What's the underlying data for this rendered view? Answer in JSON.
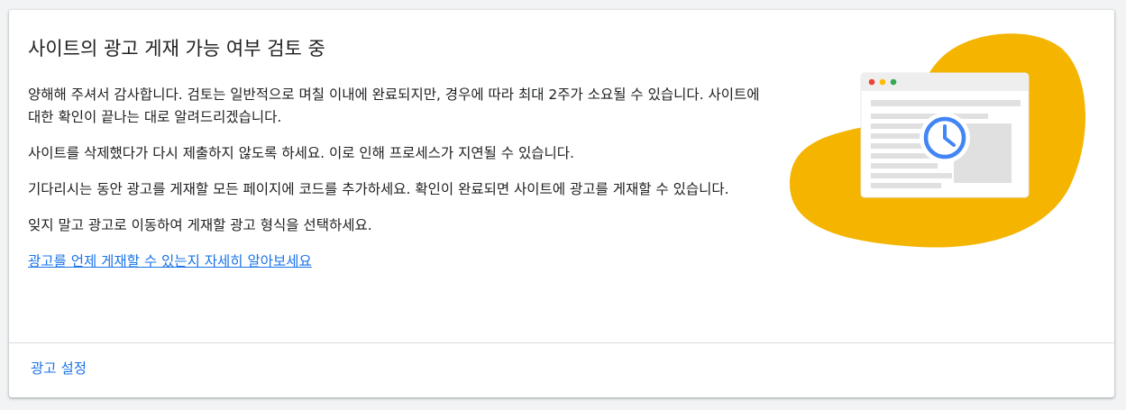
{
  "card": {
    "title": "사이트의 광고 게재 가능 여부 검토 중",
    "paragraphs": [
      "양해해 주셔서 감사합니다. 검토는 일반적으로 며칠 이내에 완료되지만, 경우에 따라 최대 2주가 소요될 수 있습니다. 사이트에 대한 확인이 끝나는 대로 알려드리겠습니다.",
      "사이트를 삭제했다가 다시 제출하지 않도록 하세요. 이로 인해 프로세스가 지연될 수 있습니다.",
      "기다리시는 동안 광고를 게재할 모든 페이지에 코드를 추가하세요. 확인이 완료되면 사이트에 광고를 게재할 수 있습니다.",
      "잊지 말고 광고로 이동하여 게재할 광고 형식을 선택하세요."
    ],
    "learn_more_link": "광고를 언제 게재할 수 있는지 자세히 알아보세요",
    "footer_action": "광고 설정"
  },
  "illustration": {
    "icon": "clock-icon",
    "blob_color": "#f4b400",
    "window_dots": [
      "#ea4335",
      "#fbbc04",
      "#34a853"
    ],
    "clock_color": "#4285f4"
  }
}
